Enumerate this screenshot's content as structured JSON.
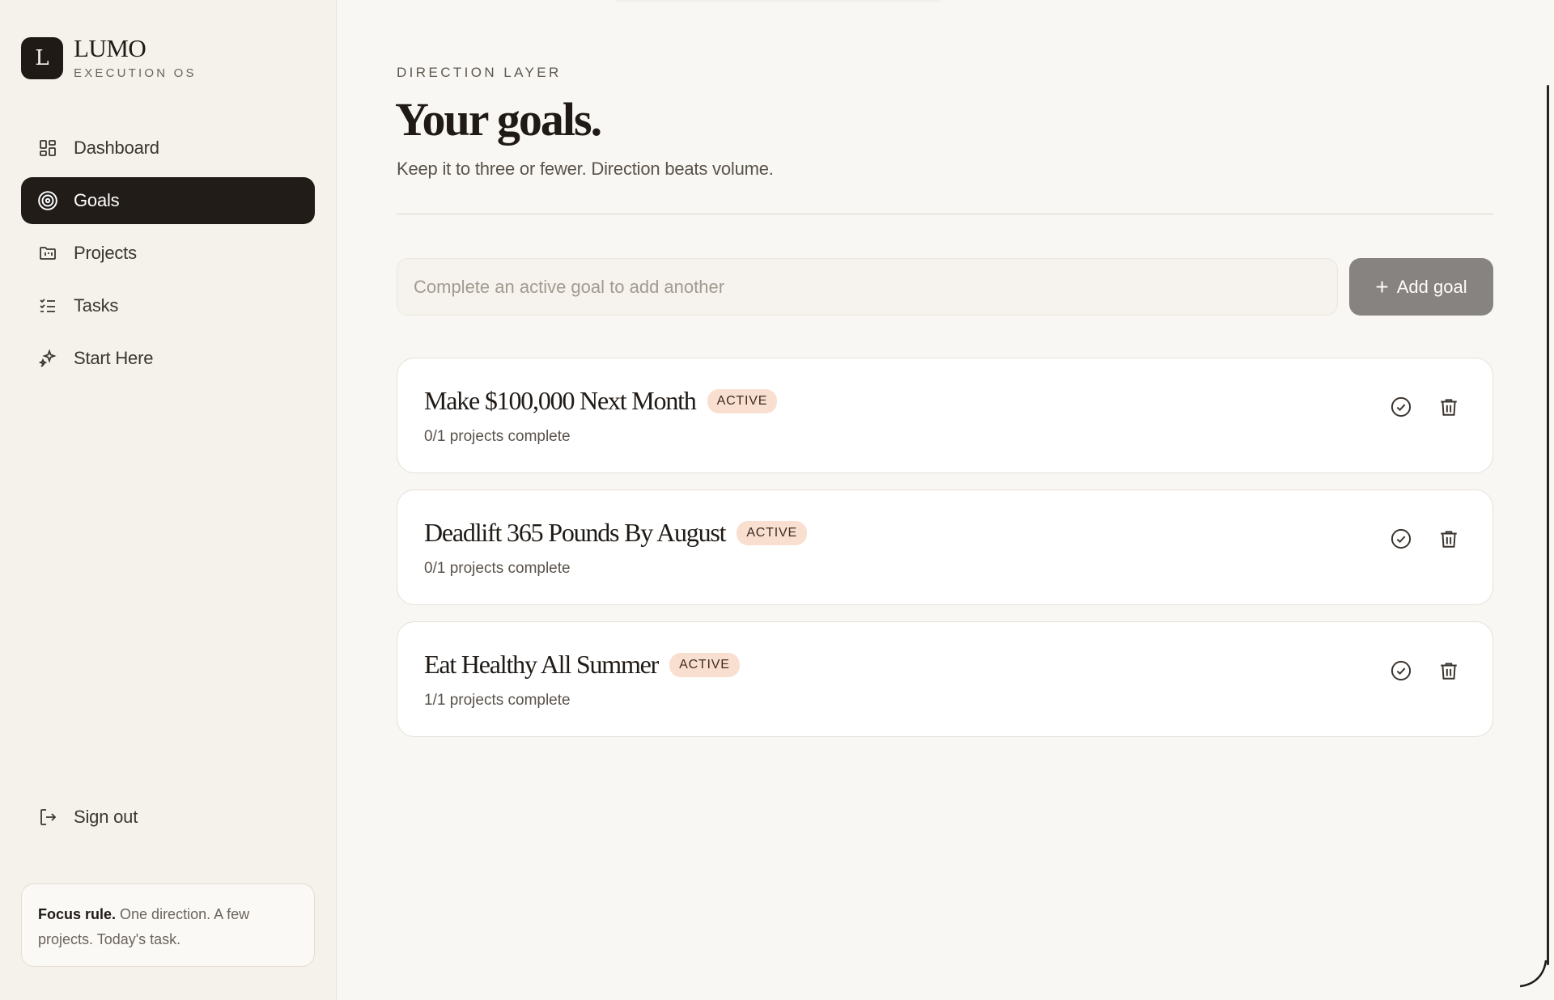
{
  "brand": {
    "logo_letter": "L",
    "name": "LUMO",
    "subtitle": "EXECUTION OS"
  },
  "nav": {
    "items": [
      {
        "label": "Dashboard",
        "icon": "dashboard-grid-icon",
        "active": false
      },
      {
        "label": "Goals",
        "icon": "target-icon",
        "active": true
      },
      {
        "label": "Projects",
        "icon": "folder-icon",
        "active": false
      },
      {
        "label": "Tasks",
        "icon": "checklist-icon",
        "active": false
      },
      {
        "label": "Start Here",
        "icon": "sparkle-icon",
        "active": false
      }
    ],
    "signout": {
      "label": "Sign out",
      "icon": "logout-icon"
    }
  },
  "focus_card": {
    "bold": "Focus rule.",
    "text": " One direction. A few projects. Today's task."
  },
  "header": {
    "eyebrow": "DIRECTION LAYER",
    "title": "Your goals.",
    "subtitle": "Keep it to three or fewer. Direction beats volume."
  },
  "add_goal": {
    "placeholder": "Complete an active goal to add another",
    "button_label": "Add goal",
    "button_icon": "plus-icon"
  },
  "goals": [
    {
      "title": "Make $100,000 Next Month",
      "status": "ACTIVE",
      "progress": "0/1 projects complete"
    },
    {
      "title": "Deadlift 365 Pounds By August",
      "status": "ACTIVE",
      "progress": "0/1 projects complete"
    },
    {
      "title": "Eat Healthy All Summer",
      "status": "ACTIVE",
      "progress": "1/1 projects complete"
    }
  ],
  "colors": {
    "background": "#f9f7f3",
    "sidebar": "#f5f2ec",
    "active_nav": "#211c18",
    "badge": "#f9dfd0",
    "add_button": "#878380"
  }
}
